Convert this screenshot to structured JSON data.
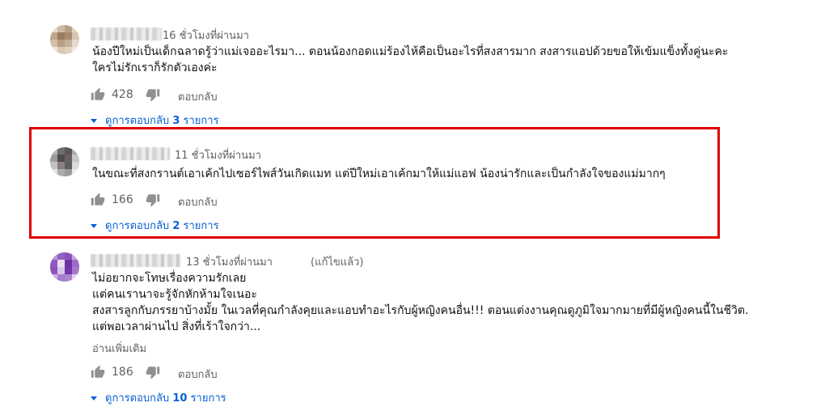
{
  "colors": {
    "link": "#065fd4",
    "meta": "#606060",
    "highlight": "#e00000"
  },
  "comments": [
    {
      "time": "16 ชั่วโมงที่ผ่านมา",
      "edited": "",
      "lines": [
        "น้องปีใหม่เป็นเด็กฉลาดรู้ว่าแม่เจออะไรมา... ตอนน้องกอดแม่ร้องไห้คือเป็นอะไรที่สงสารมาก สงสารแอปด้วยขอให้เข้มแข็งทั้งคู่นะคะ",
        "ใครไม่รักเราก็รักตัวเองค่ะ"
      ],
      "read_more": "",
      "likes": "428",
      "reply_label": "ตอบกลับ",
      "view_replies_prefix": "ดูการตอบกลับ",
      "reply_count": "3",
      "reply_suffix": "รายการ"
    },
    {
      "time": "11 ชั่วโมงที่ผ่านมา",
      "edited": "",
      "lines": [
        "ในขณะที่สงกรานต์เอาเค้กไปเซอร์ไพส์วันเกิดแมท แต่ปีใหม่เอาเค้กมาให้แม่แอฟ น้องน่ารักและเป็นกำลังใจของแม่มากๆ"
      ],
      "read_more": "",
      "likes": "166",
      "reply_label": "ตอบกลับ",
      "view_replies_prefix": "ดูการตอบกลับ",
      "reply_count": "2",
      "reply_suffix": "รายการ"
    },
    {
      "time": "13 ชั่วโมงที่ผ่านมา",
      "edited": "(แก้ไขแล้ว)",
      "lines": [
        "ไม่อยากจะโทษเรื่องความรักเลย",
        "แต่คนเรานาจะรู้จักหักห้ามใจเนอะ",
        "สงสารลูกกับภรรยาบ้างมั้ย ในเวลที่คุณกำลังคุยและแอบทำอะไรกับผู้หญิงคนอื่น!!! ตอนแต่งงานคุณดูภูมิใจมากมายที่มีผู้หญิงคนนี้ในชีวิต.",
        "แต่พอเวลาผ่านไป สิ่งที่เร้าใจกว่า..."
      ],
      "read_more": "อ่านเพิ่มเติม",
      "likes": "186",
      "reply_label": "ตอบกลับ",
      "view_replies_prefix": "ดูการตอบกลับ",
      "reply_count": "10",
      "reply_suffix": "รายการ"
    }
  ]
}
